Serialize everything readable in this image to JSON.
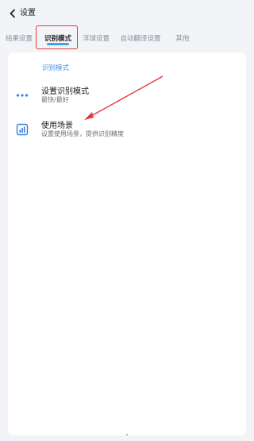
{
  "header": {
    "title": "设置",
    "back_icon": "chevron-left-icon"
  },
  "tabs": [
    {
      "label": "结果设置",
      "active": false
    },
    {
      "label": "识别模式",
      "active": true
    },
    {
      "label": "浮球设置",
      "active": false
    },
    {
      "label": "自动翻译设置",
      "active": false
    },
    {
      "label": "其他",
      "active": false
    }
  ],
  "section": {
    "title": "识别模式"
  },
  "items": [
    {
      "title": "设置识别模式",
      "subtitle": "最快/最好",
      "icon": "more-dots-icon"
    },
    {
      "title": "使用场景",
      "subtitle": "设置使用场景，提供识别精度",
      "icon": "chart-icon"
    }
  ],
  "colors": {
    "accent": "#3ea6e0",
    "section_title": "#4a8ee0",
    "annotation": "#e03a3a",
    "background": "#f3f4f8",
    "card": "#ffffff"
  }
}
